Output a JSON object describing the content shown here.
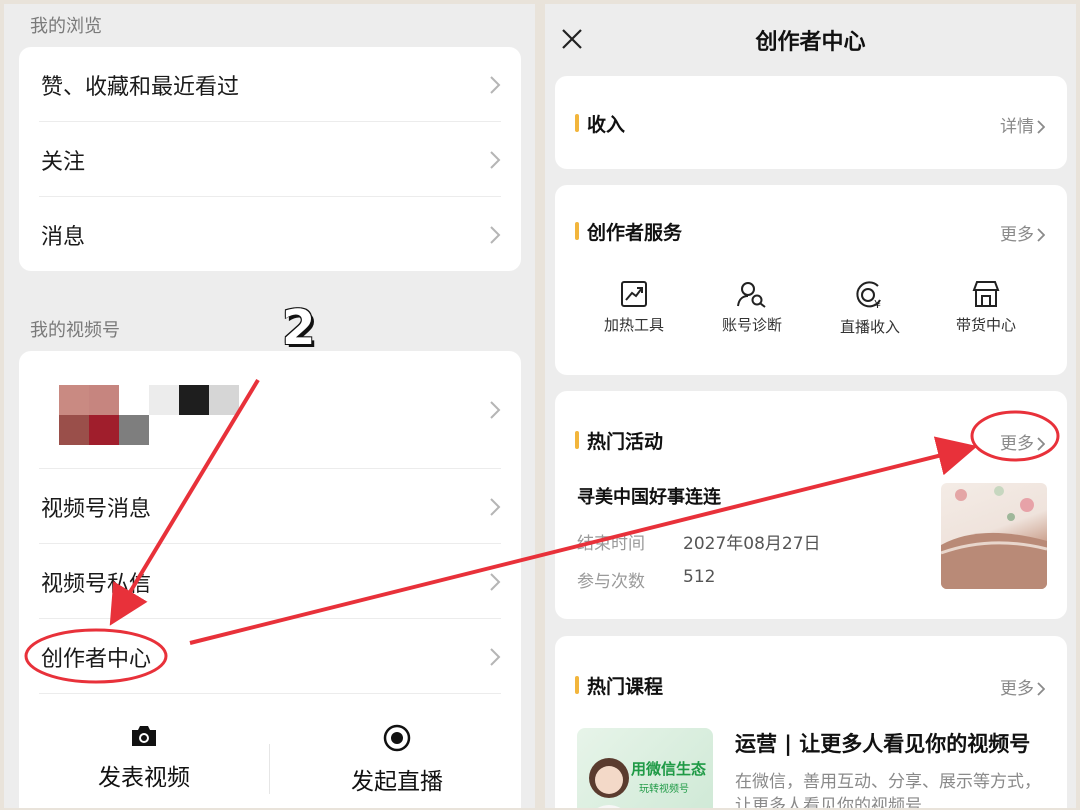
{
  "left": {
    "browse_header": "我的浏览",
    "browse_items": [
      "赞、收藏和最近看过",
      "关注",
      "消息"
    ],
    "channels_header": "我的视频号",
    "channel_items": [
      "视频号消息",
      "视频号私信",
      "创作者中心"
    ],
    "actions": {
      "post_video": "发表视频",
      "start_live": "发起直播"
    }
  },
  "right": {
    "title": "创作者中心",
    "income": {
      "title": "收入",
      "detail": "详情"
    },
    "services": {
      "title": "创作者服务",
      "more": "更多",
      "items": [
        "加热工具",
        "账号诊断",
        "直播收入",
        "带货中心"
      ]
    },
    "activities": {
      "title": "热门活动",
      "more": "更多",
      "item_title": "寻美中国好事连连",
      "end_label": "结束时间",
      "end_value": "2027年08月27日",
      "count_label": "参与次数",
      "count_value": "512"
    },
    "courses": {
      "title": "热门课程",
      "more": "更多",
      "item_title": "运营 | 让更多人看见你的视频号",
      "item_desc": "在微信，善用互动、分享、展示等方式，让更多人看见你的视频号",
      "thumb_text": "用微信生态",
      "thumb_sub": "玩转视频号"
    }
  },
  "annotation": {
    "step": "2"
  },
  "colors": {
    "accent": "#f2b53c",
    "annotation": "#e8313a",
    "panel_bg": "#ededed"
  }
}
